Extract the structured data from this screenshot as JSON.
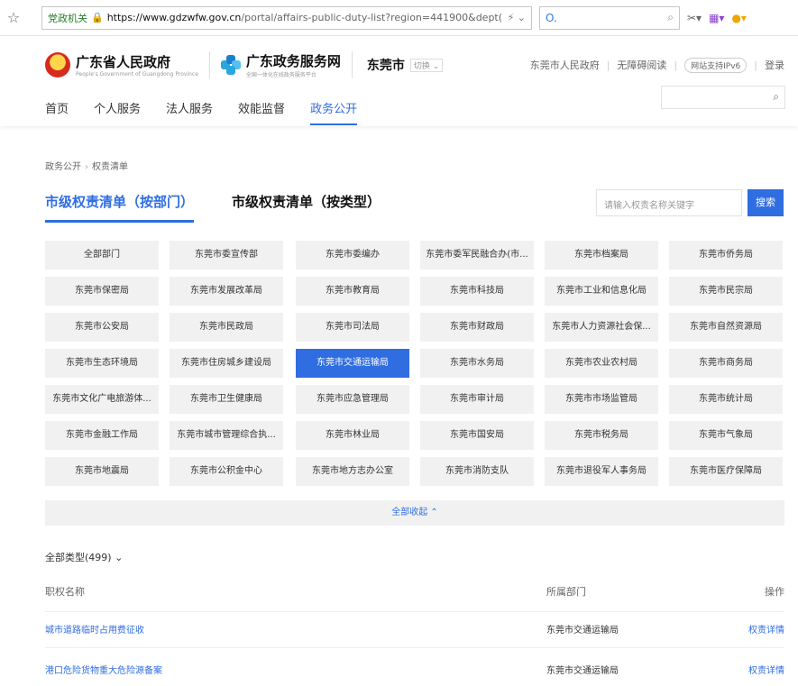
{
  "browser": {
    "badge": "党政机关",
    "url_main": "https://www.gdzwfw.gov.cn",
    "url_rest": "/portal/affairs-public-duty-list?region=441900&dept(",
    "search_text": "O."
  },
  "header": {
    "brand1_title": "广东省人民政府",
    "brand1_sub": "People's Government of Guangdong Province",
    "brand2_title": "广东政务服务网",
    "brand2_sub": "全国一体化在线政务服务平台",
    "city": "东莞市",
    "switch": "切换",
    "links": [
      "东莞市人民政府",
      "无障碍阅读",
      "网站支持IPv6",
      "登录"
    ],
    "nav": [
      "首页",
      "个人服务",
      "法人服务",
      "效能监督",
      "政务公开"
    ],
    "active_nav": "政务公开"
  },
  "breadcrumb": [
    "政务公开",
    "权责清单"
  ],
  "tabs": [
    "市级权责清单（按部门）",
    "市级权责清单（按类型）"
  ],
  "search": {
    "placeholder": "请输入权责名称关键字",
    "button": "搜索"
  },
  "departments": [
    [
      "全部部门",
      "东莞市委宣传部",
      "东莞市委编办",
      "东莞市委军民融合办(市...",
      "东莞市档案局",
      "东莞市侨务局"
    ],
    [
      "东莞市保密局",
      "东莞市发展改革局",
      "东莞市教育局",
      "东莞市科技局",
      "东莞市工业和信息化局",
      "东莞市民宗局"
    ],
    [
      "东莞市公安局",
      "东莞市民政局",
      "东莞市司法局",
      "东莞市财政局",
      "东莞市人力资源社会保...",
      "东莞市自然资源局"
    ],
    [
      "东莞市生态环境局",
      "东莞市住房城乡建设局",
      "东莞市交通运输局",
      "东莞市水务局",
      "东莞市农业农村局",
      "东莞市商务局"
    ],
    [
      "东莞市文化广电旅游体...",
      "东莞市卫生健康局",
      "东莞市应急管理局",
      "东莞市审计局",
      "东莞市市场监管局",
      "东莞市统计局"
    ],
    [
      "东莞市金融工作局",
      "东莞市城市管理综合执...",
      "东莞市林业局",
      "东莞市国安局",
      "东莞市税务局",
      "东莞市气象局"
    ],
    [
      "东莞市地震局",
      "东莞市公积金中心",
      "东莞市地方志办公室",
      "东莞市消防支队",
      "东莞市退役军人事务局",
      "东莞市医疗保障局"
    ]
  ],
  "active_department": "东莞市交通运输局",
  "collapse_label": "全部收起 ⌃",
  "all_types": "全部类型(499) ⌄",
  "table": {
    "headers": [
      "职权名称",
      "所属部门",
      "操作"
    ],
    "rows": [
      {
        "name": "城市道路临时占用费征收",
        "dept": "东莞市交通运输局",
        "op": "权责详情"
      },
      {
        "name": "港口危险货物重大危险源备案",
        "dept": "东莞市交通运输局",
        "op": "权责详情"
      }
    ]
  }
}
